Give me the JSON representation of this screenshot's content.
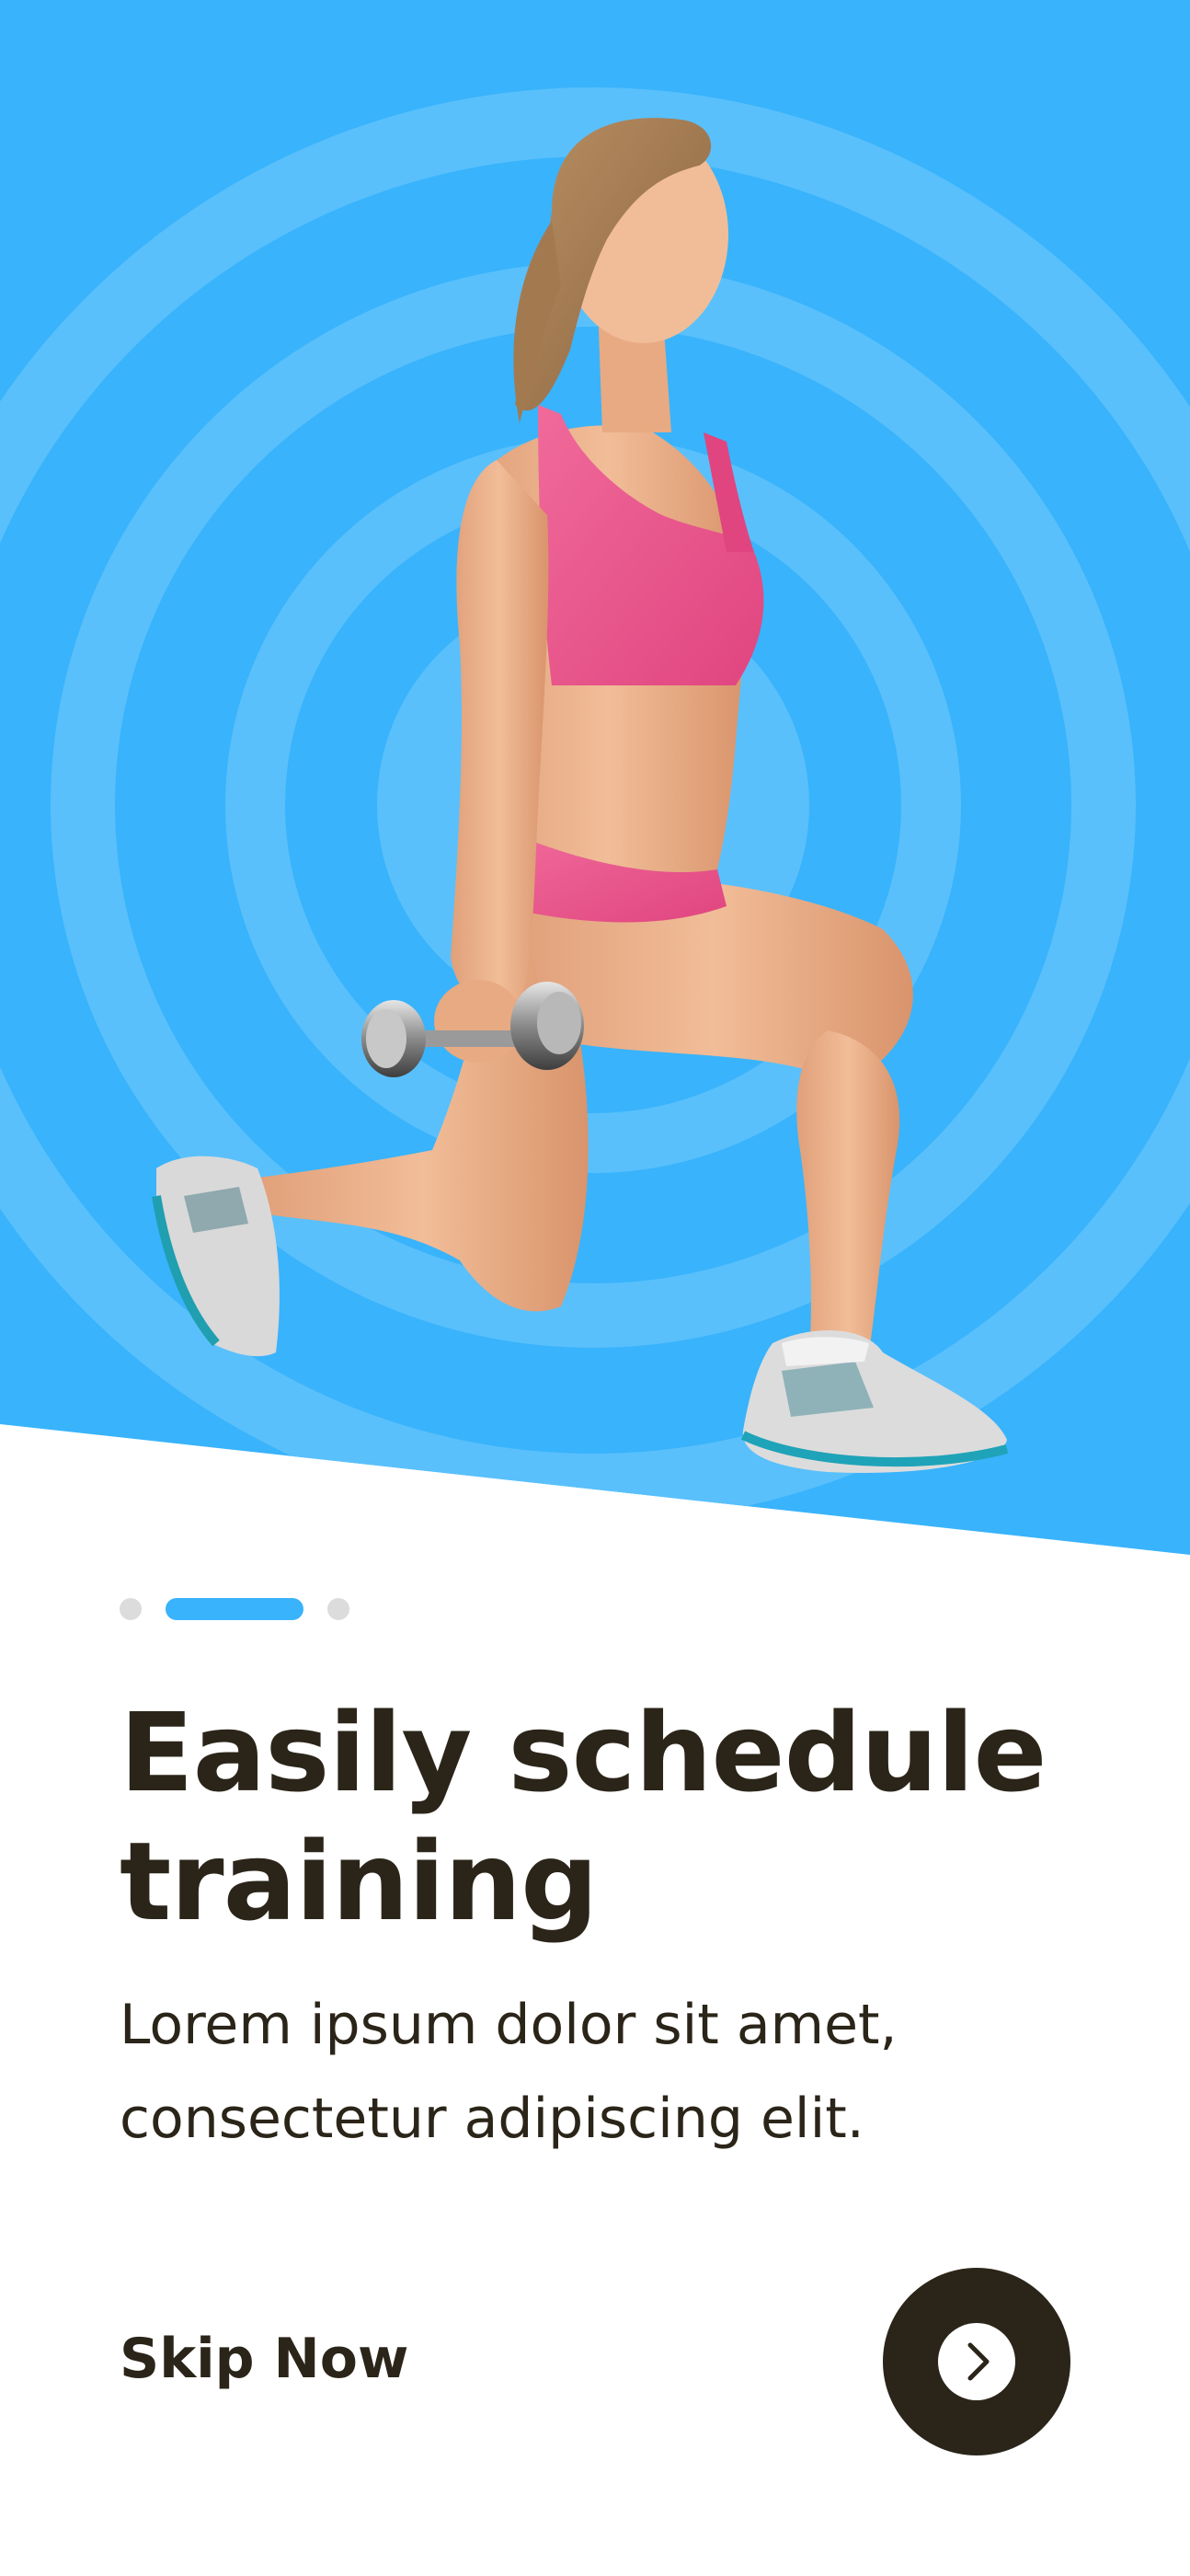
{
  "onboarding": {
    "title": "Easily schedule training",
    "subtitle": "Lorem ipsum dolor sit amet, consectetur adipiscing elit.",
    "skip_label": "Skip Now",
    "next_icon": "chevron-right-icon",
    "pagination": {
      "total": 3,
      "active_index": 1
    }
  },
  "theme": {
    "accent": "#39b3fb",
    "ring_light": "#59c0fc",
    "dark": "#2b2519",
    "inactive_dot": "#dcdcdc"
  },
  "hero": {
    "image": "woman-lunge-dumbbell-illustration"
  }
}
